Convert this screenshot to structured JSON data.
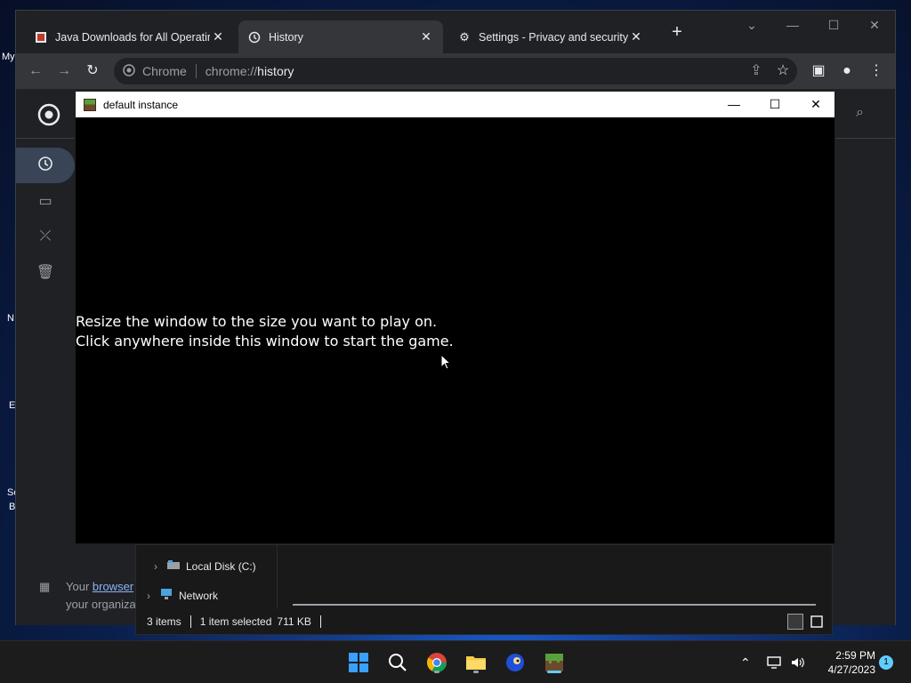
{
  "desktop": {
    "labels": [
      "My",
      "N",
      "E",
      "Sc",
      "B"
    ]
  },
  "chrome": {
    "tabs": [
      {
        "title": "Java Downloads for All Operating",
        "icon": "java-icon"
      },
      {
        "title": "History",
        "icon": "history-icon"
      },
      {
        "title": "Settings - Privacy and security",
        "icon": "gear-icon"
      }
    ],
    "omnibox": {
      "site": "Chrome",
      "url_scheme": "chrome://",
      "url_path": "history"
    },
    "managed_text_prefix": "Your ",
    "managed_link": "browser",
    "managed_text_line2": "your organiza"
  },
  "explorer": {
    "tree": [
      {
        "label": "Local Disk (C:)",
        "icon": "drive-icon"
      },
      {
        "label": "Network",
        "icon": "network-icon"
      }
    ],
    "status": {
      "items": "3 items",
      "selected": "1 item selected",
      "size": "711 KB"
    }
  },
  "game_window": {
    "title": "default instance",
    "message_line1": "Resize the window to the size you want to play on.",
    "message_line2": "Click anywhere inside this window to start the game."
  },
  "taskbar": {
    "time": "2:59 PM",
    "date": "4/27/2023",
    "notifications": "1"
  }
}
